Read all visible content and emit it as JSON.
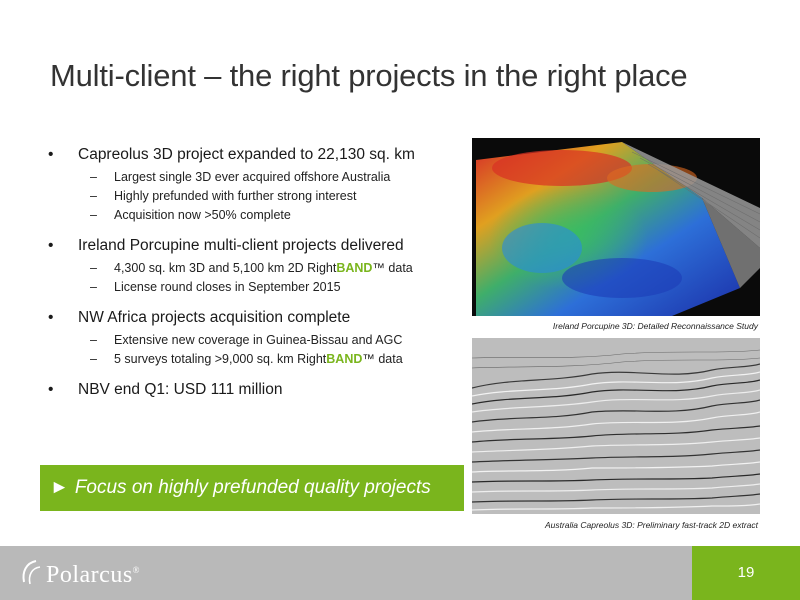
{
  "title": "Multi-client – the right projects in the right place",
  "bullets": {
    "b1": {
      "text": "Capreolus 3D project expanded to 22,130 sq. km",
      "sub": [
        "Largest single 3D ever acquired offshore Australia",
        "Highly prefunded with further strong interest",
        "Acquisition now >50% complete"
      ]
    },
    "b2": {
      "text": "Ireland Porcupine multi-client projects delivered",
      "sub0_pre": "4,300 sq. km 3D and 5,100 km 2D Right",
      "sub0_band": "BAND",
      "sub0_post": "™ data",
      "sub1": "License round closes in September 2015"
    },
    "b3": {
      "text": "NW Africa projects acquisition complete",
      "sub0": "Extensive new coverage in Guinea-Bissau and AGC",
      "sub1_pre": "5 surveys totaling >9,000 sq. km Right",
      "sub1_band": "BAND",
      "sub1_post": "™ data"
    },
    "b4": {
      "text": "NBV end Q1: USD 111 million"
    },
    "bullet_char": "•",
    "dash_char": "–"
  },
  "focus": {
    "arrow": "►",
    "text": "Focus on highly prefunded quality projects"
  },
  "images": {
    "top_caption": "Ireland Porcupine 3D: Detailed Reconnaissance Study",
    "bottom_caption": "Australia Capreolus 3D: Preliminary fast-track 2D extract"
  },
  "footer": {
    "logo_text": "Polarcus",
    "logo_mark": "®",
    "page_number": "19"
  },
  "colors": {
    "brand_green": "#7ab51d",
    "footer_gray": "#b9b9b9"
  }
}
